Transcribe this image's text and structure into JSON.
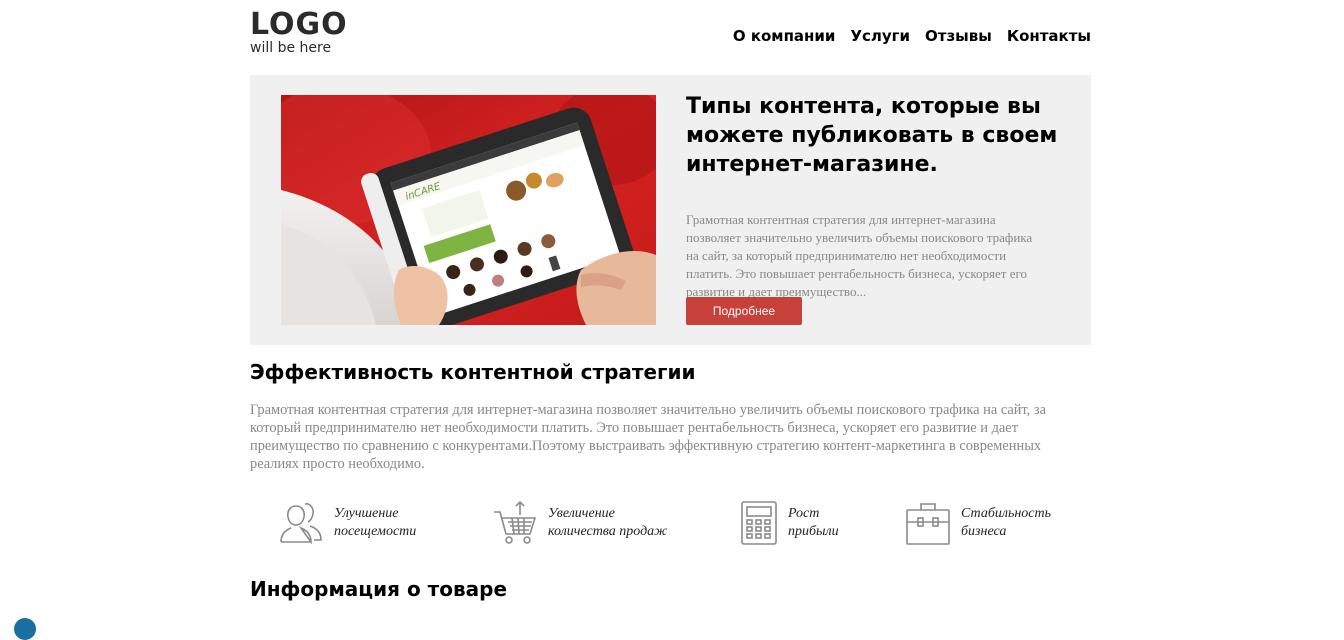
{
  "header": {
    "logo_main": "LOGO",
    "logo_sub": "will be here",
    "nav": [
      "О компании",
      "Услуги",
      "Отзывы",
      "Контакты"
    ]
  },
  "hero": {
    "title": "Типы контента, которые вы можете публиковать в своем интернет-магазине.",
    "text": "Грамотная контентная стратегия для интернет-магазина позволяет значительно увеличить объемы поискового трафика на сайт, за который предпринимателю нет необходимости платить. Это повышает рентабельность бизнеса, ускоряет его развитие и дает преимущество...",
    "button": "Подробнее",
    "tablet_brand": "inCARE",
    "colors": {
      "button": "#c8403a",
      "background": "#f0f0f0"
    }
  },
  "section1": {
    "title": "Эффективность контентной стратегии",
    "text": "Грамотная контентная стратегия для интернет-магазина позволяет значительно увеличить объемы поискового трафика на сайт, за который предпринимателю нет необходимости платить. Это повышает рентабельность бизнеса, ускоряет его развитие и дает преимущество по сравнению с конкурентами.Поэтому выстраивать эффективную стратегию контент-маркетинга в современных реалиях просто необходимо."
  },
  "features": [
    {
      "icon": "users-icon",
      "label": "Улучшение\nпосещемости"
    },
    {
      "icon": "cart-icon",
      "label": "Увеличение\nколичества продаж"
    },
    {
      "icon": "calculator-icon",
      "label": "Рост\nприбыли"
    },
    {
      "icon": "briefcase-icon",
      "label": "Стабильность\nбизнеса"
    }
  ],
  "section2": {
    "title": "Информация о товаре"
  }
}
